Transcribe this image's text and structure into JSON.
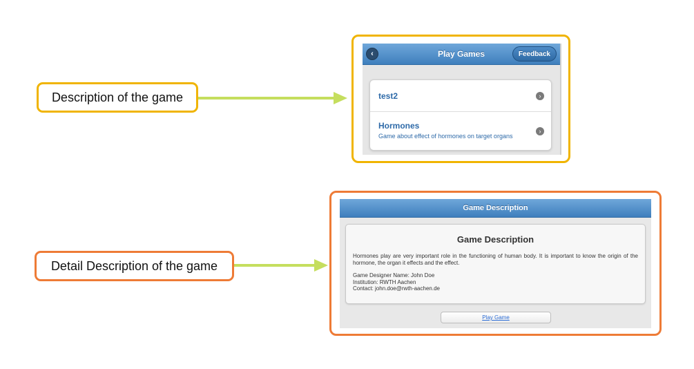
{
  "callouts": {
    "game_description": "Description of the game",
    "detail_description": "Detail Description of the game"
  },
  "play_games_screen": {
    "title": "Play Games",
    "back_icon": "chevron-left-icon",
    "feedback_label": "Feedback",
    "items": [
      {
        "title": "test2",
        "subtitle": ""
      },
      {
        "title": "Hormones",
        "subtitle": "Game about effect of hormones on target organs"
      }
    ]
  },
  "game_description_screen": {
    "header_title": "Game Description",
    "heading": "Game Description",
    "description": "Hormones play are very important role in the functioning of human body. It is important to know the origin of the hormone, the organ it effects and the effect.",
    "designer": "Game Designer Name: John Doe",
    "institution": "Institution: RWTH Aachen",
    "contact": "Contact: john.doe@rwth-aachen.de",
    "play_button": "Play Game"
  },
  "colors": {
    "callout_yellow": "#f0b400",
    "callout_orange": "#ee7b36",
    "arrow_green": "#c5de5e",
    "header_blue": "#4f8ecb"
  }
}
